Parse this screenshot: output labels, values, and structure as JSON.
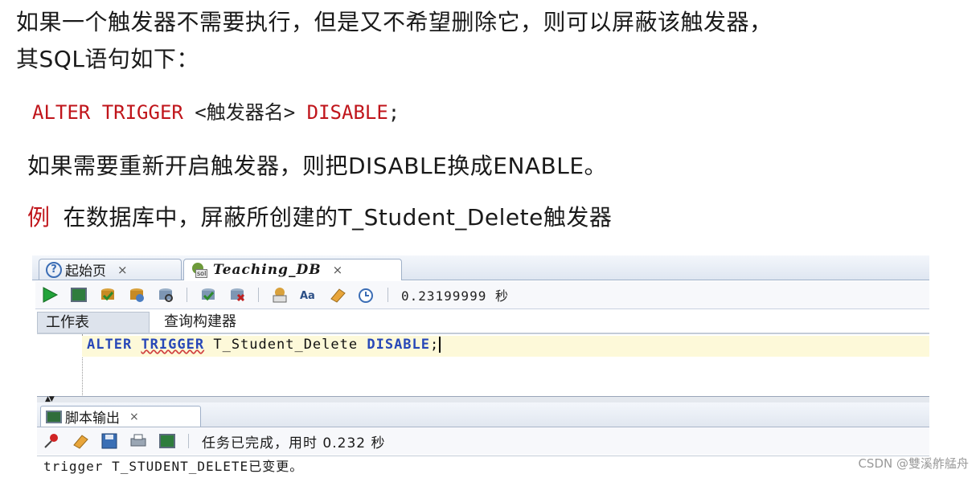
{
  "doc": {
    "line1": "如果一个触发器不需要执行，但是又不希望删除它，则可以屏蔽该触发器，",
    "line2": "其SQL语句如下：",
    "syntax_a": "ALTER TRIGGER ",
    "syntax_b": "<触发器名>",
    "syntax_c": " DISABLE",
    "syntax_d": ";",
    "line4": "如果需要重新开启触发器，则把DISABLE换成ENABLE。",
    "example_tag": "例",
    "example_text": "在数据库中，屏蔽所创建的T_Student_Delete触发器"
  },
  "ide": {
    "tabs": [
      {
        "label": "起始页",
        "close": "×"
      },
      {
        "label": "Teaching_DB",
        "close": "×"
      }
    ],
    "exec_time": "0.23199999 秒",
    "subtabs": [
      "工作表",
      "查询构建器"
    ],
    "editor": {
      "kw1": "ALTER",
      "kw2": "TRIGGER",
      "ident": "T_Student_Delete",
      "kw3": "DISABLE",
      "end": ";"
    },
    "output_tab": {
      "label": "脚本输出",
      "close": "×"
    },
    "status": "任务已完成，用时 0.232 秒",
    "output": "trigger T_STUDENT_DELETE已变更。"
  },
  "watermark": "CSDN @雙溪舴艋舟",
  "colors": {
    "accent_red": "#c0151b",
    "keyword_blue": "#2848b8"
  }
}
